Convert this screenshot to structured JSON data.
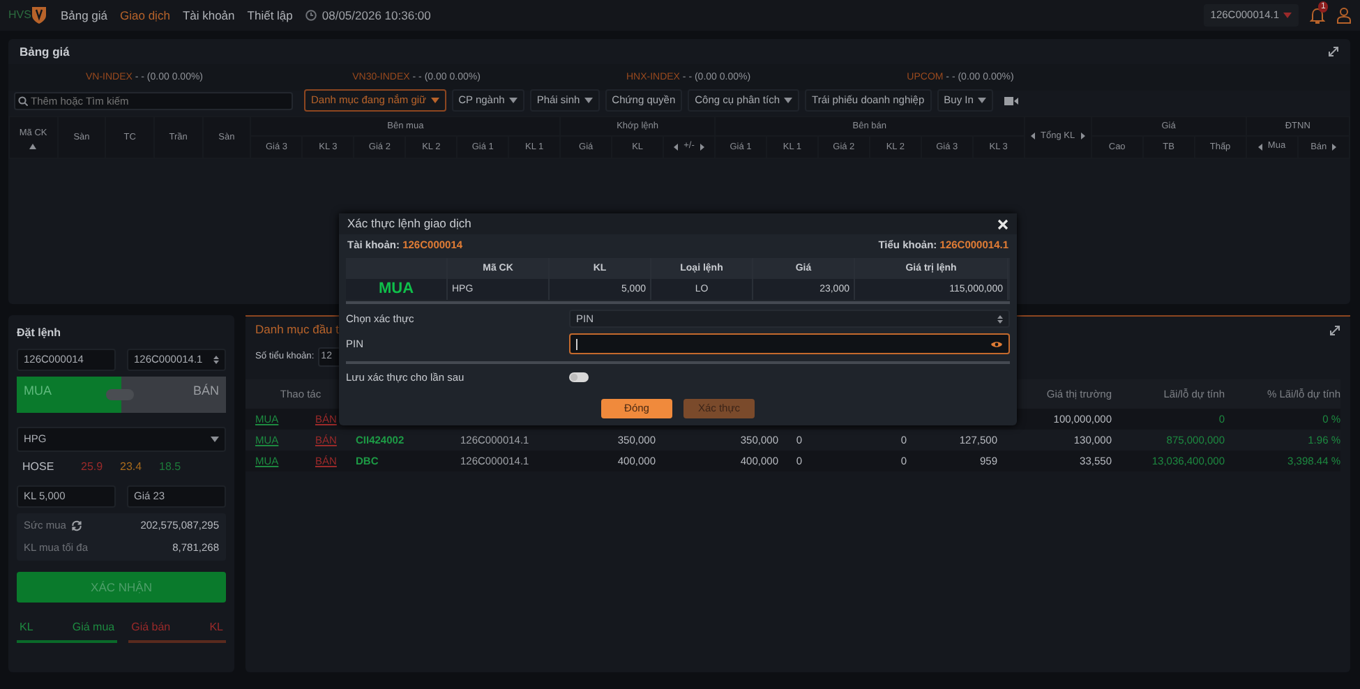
{
  "nav": {
    "logo": "HVS",
    "items": [
      {
        "label": "Bảng giá",
        "selected": false
      },
      {
        "label": "Giao dịch",
        "selected": true
      },
      {
        "label": "Tài khoản",
        "selected": false
      },
      {
        "label": "Thiết lập",
        "selected": false
      }
    ],
    "datetime": "08/05/2026 10:36:00",
    "account": "126C000014.1",
    "notification_count": "1"
  },
  "price_board": {
    "title": "Bảng giá",
    "indices": [
      {
        "name": "VN-INDEX",
        "value": "- - (0.00 0.00%)"
      },
      {
        "name": "VN30-INDEX",
        "value": "- - (0.00 0.00%)"
      },
      {
        "name": "HNX-INDEX",
        "value": "- - (0.00 0.00%)"
      },
      {
        "name": "UPCOM",
        "value": "- - (0.00 0.00%)"
      }
    ],
    "search": {
      "placeholder": "Thêm hoặc Tìm kiếm"
    },
    "filters": [
      {
        "label": "Danh mục đang nắm giữ",
        "dropdown": true,
        "selected": true
      },
      {
        "label": "CP ngành",
        "dropdown": true,
        "selected": false
      },
      {
        "label": "Phái sinh",
        "dropdown": true,
        "selected": false
      },
      {
        "label": "Chứng quyền",
        "dropdown": false,
        "selected": false
      },
      {
        "label": "Công cụ phân tích",
        "dropdown": true,
        "selected": false
      },
      {
        "label": "Trái phiếu doanh nghiệp",
        "dropdown": false,
        "selected": false
      },
      {
        "label": "Buy In",
        "dropdown": true,
        "selected": false
      }
    ],
    "header": [
      {
        "label": "Mã CK",
        "sorted": true
      },
      {
        "label": "Sàn"
      },
      {
        "label": "TC"
      },
      {
        "label": "Trần"
      },
      {
        "label": "Sàn"
      },
      {
        "group": "Bên mua",
        "columns": [
          {
            "label": "Giá 3"
          },
          {
            "label": "KL 3"
          },
          {
            "label": "Giá 2"
          },
          {
            "label": "KL 2"
          },
          {
            "label": "Giá 1"
          },
          {
            "label": "KL 1"
          }
        ]
      },
      {
        "group": "Khớp lệnh",
        "columns": [
          {
            "label": "Giá"
          },
          {
            "label": "KL"
          },
          {
            "label": "+/-",
            "arrow_left": true,
            "arrow_right": true
          }
        ]
      },
      {
        "group": "Bên bán",
        "columns": [
          {
            "label": "Giá 1"
          },
          {
            "label": "KL 1"
          },
          {
            "label": "Giá 2"
          },
          {
            "label": "KL 2"
          },
          {
            "label": "Giá 3"
          },
          {
            "label": "KL 3"
          }
        ]
      },
      {
        "label": "Tổng KL",
        "arrow_left": true,
        "arrow_right": true
      },
      {
        "group": "Giá",
        "columns": [
          {
            "label": "Cao"
          },
          {
            "label": "TB"
          },
          {
            "label": "Thấp"
          }
        ]
      },
      {
        "group": "ĐTNN",
        "columns": [
          {
            "label": "Mua",
            "arrow_left": true,
            "arrow_right": false
          },
          {
            "label": "Bán",
            "arrow_left": false,
            "arrow_right": true
          }
        ]
      }
    ]
  },
  "order_panel": {
    "title": "Đặt lệnh",
    "account": "126C000014",
    "sub_account": "126C000014.1",
    "sides": [
      {
        "label": "MUA",
        "selected": true
      },
      {
        "label": "BÁN",
        "selected": false
      }
    ],
    "symbol": "HPG",
    "exchange": "HOSE",
    "prices": [
      {
        "kind": "ceiling",
        "text": "25.9"
      },
      {
        "kind": "reference",
        "text": "23.4"
      },
      {
        "kind": "floor",
        "text": "18.5"
      }
    ],
    "quantity": {
      "label": "KL",
      "value": "5,000"
    },
    "price": {
      "label": "Giá",
      "value": "23"
    },
    "buying_power": {
      "label": "Sức mua",
      "value": "202,575,087,295"
    },
    "max_quantity": {
      "label": "KL mua tối đa",
      "value": "8,781,268"
    },
    "confirm_button": "XÁC NHẬN",
    "book_headers": [
      {
        "kind": "buy",
        "text": "KL"
      },
      {
        "kind": "buy",
        "text": "Giá mua"
      },
      {
        "kind": "sell",
        "text": "Giá bán"
      },
      {
        "kind": "sell",
        "text": "KL"
      }
    ]
  },
  "portfolio": {
    "tab": "Danh mục đầu t",
    "sub_account_label": "Số tiểu khoản:",
    "sub_account_value": "12",
    "action_column": "Thao tác",
    "value_columns": [
      "Giá thị trường",
      "Lãi/lỗ dự tính",
      "% Lãi/lỗ dự tính"
    ],
    "rows": [
      {
        "buy": "MUA",
        "sell": "BÁN",
        "cells": [
          "",
          "",
          "",
          "",
          "",
          "",
          "",
          "100,000,000",
          "0",
          "0 %"
        ]
      },
      {
        "buy": "MUA",
        "sell": "BÁN",
        "cells": [
          "CII424002",
          "126C000014.1",
          "350,000",
          "350,000",
          "0",
          "0",
          "127,500",
          "130,000",
          "875,000,000",
          "1.96 %"
        ]
      },
      {
        "buy": "MUA",
        "sell": "BÁN",
        "cells": [
          "DBC",
          "126C000014.1",
          "400,000",
          "400,000",
          "0",
          "0",
          "959",
          "33,550",
          "13,036,400,000",
          "3,398.44 %"
        ]
      }
    ]
  },
  "modal": {
    "title": "Xác thực lệnh giao dịch",
    "account_label": "Tài khoản:",
    "account": "126C000014",
    "sub_account_label": "Tiểu khoản:",
    "sub_account": "126C000014.1",
    "columns": [
      "Mã CK",
      "KL",
      "Loại lệnh",
      "Giá",
      "Giá trị lệnh"
    ],
    "order": {
      "side": "MUA",
      "cells": [
        "HPG",
        "5,000",
        "LO",
        "23,000",
        "115,000,000"
      ]
    },
    "auth_label": "Chọn xác thực",
    "auth_method": "PIN",
    "pin_label": "PIN",
    "save_label": "Lưu xác thực cho lần sau",
    "save_on": false,
    "buttons": [
      {
        "label": "Đóng",
        "kind": "secondary",
        "disabled": false
      },
      {
        "label": "Xác thực",
        "kind": "primary",
        "disabled": true
      }
    ]
  }
}
